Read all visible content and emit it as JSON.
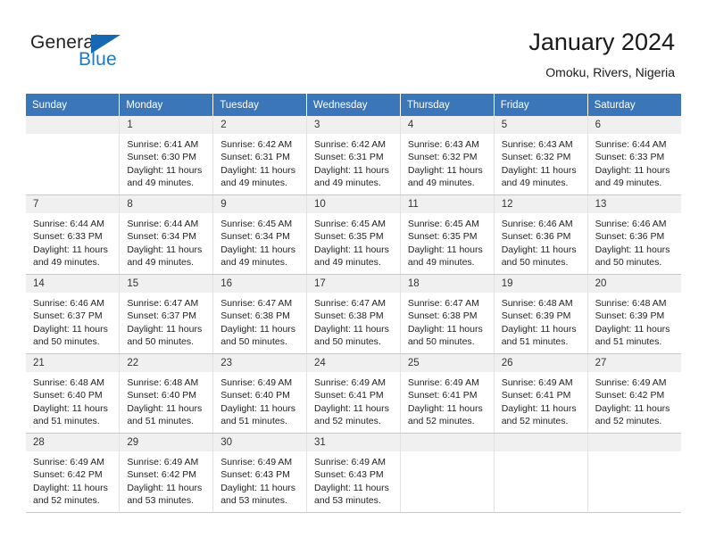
{
  "brand": {
    "name_top": "General",
    "name_bottom": "Blue",
    "triangle_color": "#1668b3",
    "text_color": "#231f20",
    "blue_color": "#1f7ac4"
  },
  "header": {
    "title": "January 2024",
    "subtitle": "Omoku, Rivers, Nigeria"
  },
  "calendar": {
    "header_bg": "#3a76b8",
    "daynum_bg": "#f0f0f0",
    "weekdays": [
      "Sunday",
      "Monday",
      "Tuesday",
      "Wednesday",
      "Thursday",
      "Friday",
      "Saturday"
    ],
    "weeks": [
      [
        {
          "day": "",
          "sunrise": "",
          "sunset": "",
          "daylight1": "",
          "daylight2": ""
        },
        {
          "day": "1",
          "sunrise": "Sunrise: 6:41 AM",
          "sunset": "Sunset: 6:30 PM",
          "daylight1": "Daylight: 11 hours",
          "daylight2": "and 49 minutes."
        },
        {
          "day": "2",
          "sunrise": "Sunrise: 6:42 AM",
          "sunset": "Sunset: 6:31 PM",
          "daylight1": "Daylight: 11 hours",
          "daylight2": "and 49 minutes."
        },
        {
          "day": "3",
          "sunrise": "Sunrise: 6:42 AM",
          "sunset": "Sunset: 6:31 PM",
          "daylight1": "Daylight: 11 hours",
          "daylight2": "and 49 minutes."
        },
        {
          "day": "4",
          "sunrise": "Sunrise: 6:43 AM",
          "sunset": "Sunset: 6:32 PM",
          "daylight1": "Daylight: 11 hours",
          "daylight2": "and 49 minutes."
        },
        {
          "day": "5",
          "sunrise": "Sunrise: 6:43 AM",
          "sunset": "Sunset: 6:32 PM",
          "daylight1": "Daylight: 11 hours",
          "daylight2": "and 49 minutes."
        },
        {
          "day": "6",
          "sunrise": "Sunrise: 6:44 AM",
          "sunset": "Sunset: 6:33 PM",
          "daylight1": "Daylight: 11 hours",
          "daylight2": "and 49 minutes."
        }
      ],
      [
        {
          "day": "7",
          "sunrise": "Sunrise: 6:44 AM",
          "sunset": "Sunset: 6:33 PM",
          "daylight1": "Daylight: 11 hours",
          "daylight2": "and 49 minutes."
        },
        {
          "day": "8",
          "sunrise": "Sunrise: 6:44 AM",
          "sunset": "Sunset: 6:34 PM",
          "daylight1": "Daylight: 11 hours",
          "daylight2": "and 49 minutes."
        },
        {
          "day": "9",
          "sunrise": "Sunrise: 6:45 AM",
          "sunset": "Sunset: 6:34 PM",
          "daylight1": "Daylight: 11 hours",
          "daylight2": "and 49 minutes."
        },
        {
          "day": "10",
          "sunrise": "Sunrise: 6:45 AM",
          "sunset": "Sunset: 6:35 PM",
          "daylight1": "Daylight: 11 hours",
          "daylight2": "and 49 minutes."
        },
        {
          "day": "11",
          "sunrise": "Sunrise: 6:45 AM",
          "sunset": "Sunset: 6:35 PM",
          "daylight1": "Daylight: 11 hours",
          "daylight2": "and 49 minutes."
        },
        {
          "day": "12",
          "sunrise": "Sunrise: 6:46 AM",
          "sunset": "Sunset: 6:36 PM",
          "daylight1": "Daylight: 11 hours",
          "daylight2": "and 50 minutes."
        },
        {
          "day": "13",
          "sunrise": "Sunrise: 6:46 AM",
          "sunset": "Sunset: 6:36 PM",
          "daylight1": "Daylight: 11 hours",
          "daylight2": "and 50 minutes."
        }
      ],
      [
        {
          "day": "14",
          "sunrise": "Sunrise: 6:46 AM",
          "sunset": "Sunset: 6:37 PM",
          "daylight1": "Daylight: 11 hours",
          "daylight2": "and 50 minutes."
        },
        {
          "day": "15",
          "sunrise": "Sunrise: 6:47 AM",
          "sunset": "Sunset: 6:37 PM",
          "daylight1": "Daylight: 11 hours",
          "daylight2": "and 50 minutes."
        },
        {
          "day": "16",
          "sunrise": "Sunrise: 6:47 AM",
          "sunset": "Sunset: 6:38 PM",
          "daylight1": "Daylight: 11 hours",
          "daylight2": "and 50 minutes."
        },
        {
          "day": "17",
          "sunrise": "Sunrise: 6:47 AM",
          "sunset": "Sunset: 6:38 PM",
          "daylight1": "Daylight: 11 hours",
          "daylight2": "and 50 minutes."
        },
        {
          "day": "18",
          "sunrise": "Sunrise: 6:47 AM",
          "sunset": "Sunset: 6:38 PM",
          "daylight1": "Daylight: 11 hours",
          "daylight2": "and 50 minutes."
        },
        {
          "day": "19",
          "sunrise": "Sunrise: 6:48 AM",
          "sunset": "Sunset: 6:39 PM",
          "daylight1": "Daylight: 11 hours",
          "daylight2": "and 51 minutes."
        },
        {
          "day": "20",
          "sunrise": "Sunrise: 6:48 AM",
          "sunset": "Sunset: 6:39 PM",
          "daylight1": "Daylight: 11 hours",
          "daylight2": "and 51 minutes."
        }
      ],
      [
        {
          "day": "21",
          "sunrise": "Sunrise: 6:48 AM",
          "sunset": "Sunset: 6:40 PM",
          "daylight1": "Daylight: 11 hours",
          "daylight2": "and 51 minutes."
        },
        {
          "day": "22",
          "sunrise": "Sunrise: 6:48 AM",
          "sunset": "Sunset: 6:40 PM",
          "daylight1": "Daylight: 11 hours",
          "daylight2": "and 51 minutes."
        },
        {
          "day": "23",
          "sunrise": "Sunrise: 6:49 AM",
          "sunset": "Sunset: 6:40 PM",
          "daylight1": "Daylight: 11 hours",
          "daylight2": "and 51 minutes."
        },
        {
          "day": "24",
          "sunrise": "Sunrise: 6:49 AM",
          "sunset": "Sunset: 6:41 PM",
          "daylight1": "Daylight: 11 hours",
          "daylight2": "and 52 minutes."
        },
        {
          "day": "25",
          "sunrise": "Sunrise: 6:49 AM",
          "sunset": "Sunset: 6:41 PM",
          "daylight1": "Daylight: 11 hours",
          "daylight2": "and 52 minutes."
        },
        {
          "day": "26",
          "sunrise": "Sunrise: 6:49 AM",
          "sunset": "Sunset: 6:41 PM",
          "daylight1": "Daylight: 11 hours",
          "daylight2": "and 52 minutes."
        },
        {
          "day": "27",
          "sunrise": "Sunrise: 6:49 AM",
          "sunset": "Sunset: 6:42 PM",
          "daylight1": "Daylight: 11 hours",
          "daylight2": "and 52 minutes."
        }
      ],
      [
        {
          "day": "28",
          "sunrise": "Sunrise: 6:49 AM",
          "sunset": "Sunset: 6:42 PM",
          "daylight1": "Daylight: 11 hours",
          "daylight2": "and 52 minutes."
        },
        {
          "day": "29",
          "sunrise": "Sunrise: 6:49 AM",
          "sunset": "Sunset: 6:42 PM",
          "daylight1": "Daylight: 11 hours",
          "daylight2": "and 53 minutes."
        },
        {
          "day": "30",
          "sunrise": "Sunrise: 6:49 AM",
          "sunset": "Sunset: 6:43 PM",
          "daylight1": "Daylight: 11 hours",
          "daylight2": "and 53 minutes."
        },
        {
          "day": "31",
          "sunrise": "Sunrise: 6:49 AM",
          "sunset": "Sunset: 6:43 PM",
          "daylight1": "Daylight: 11 hours",
          "daylight2": "and 53 minutes."
        },
        {
          "day": "",
          "sunrise": "",
          "sunset": "",
          "daylight1": "",
          "daylight2": ""
        },
        {
          "day": "",
          "sunrise": "",
          "sunset": "",
          "daylight1": "",
          "daylight2": ""
        },
        {
          "day": "",
          "sunrise": "",
          "sunset": "",
          "daylight1": "",
          "daylight2": ""
        }
      ]
    ]
  }
}
